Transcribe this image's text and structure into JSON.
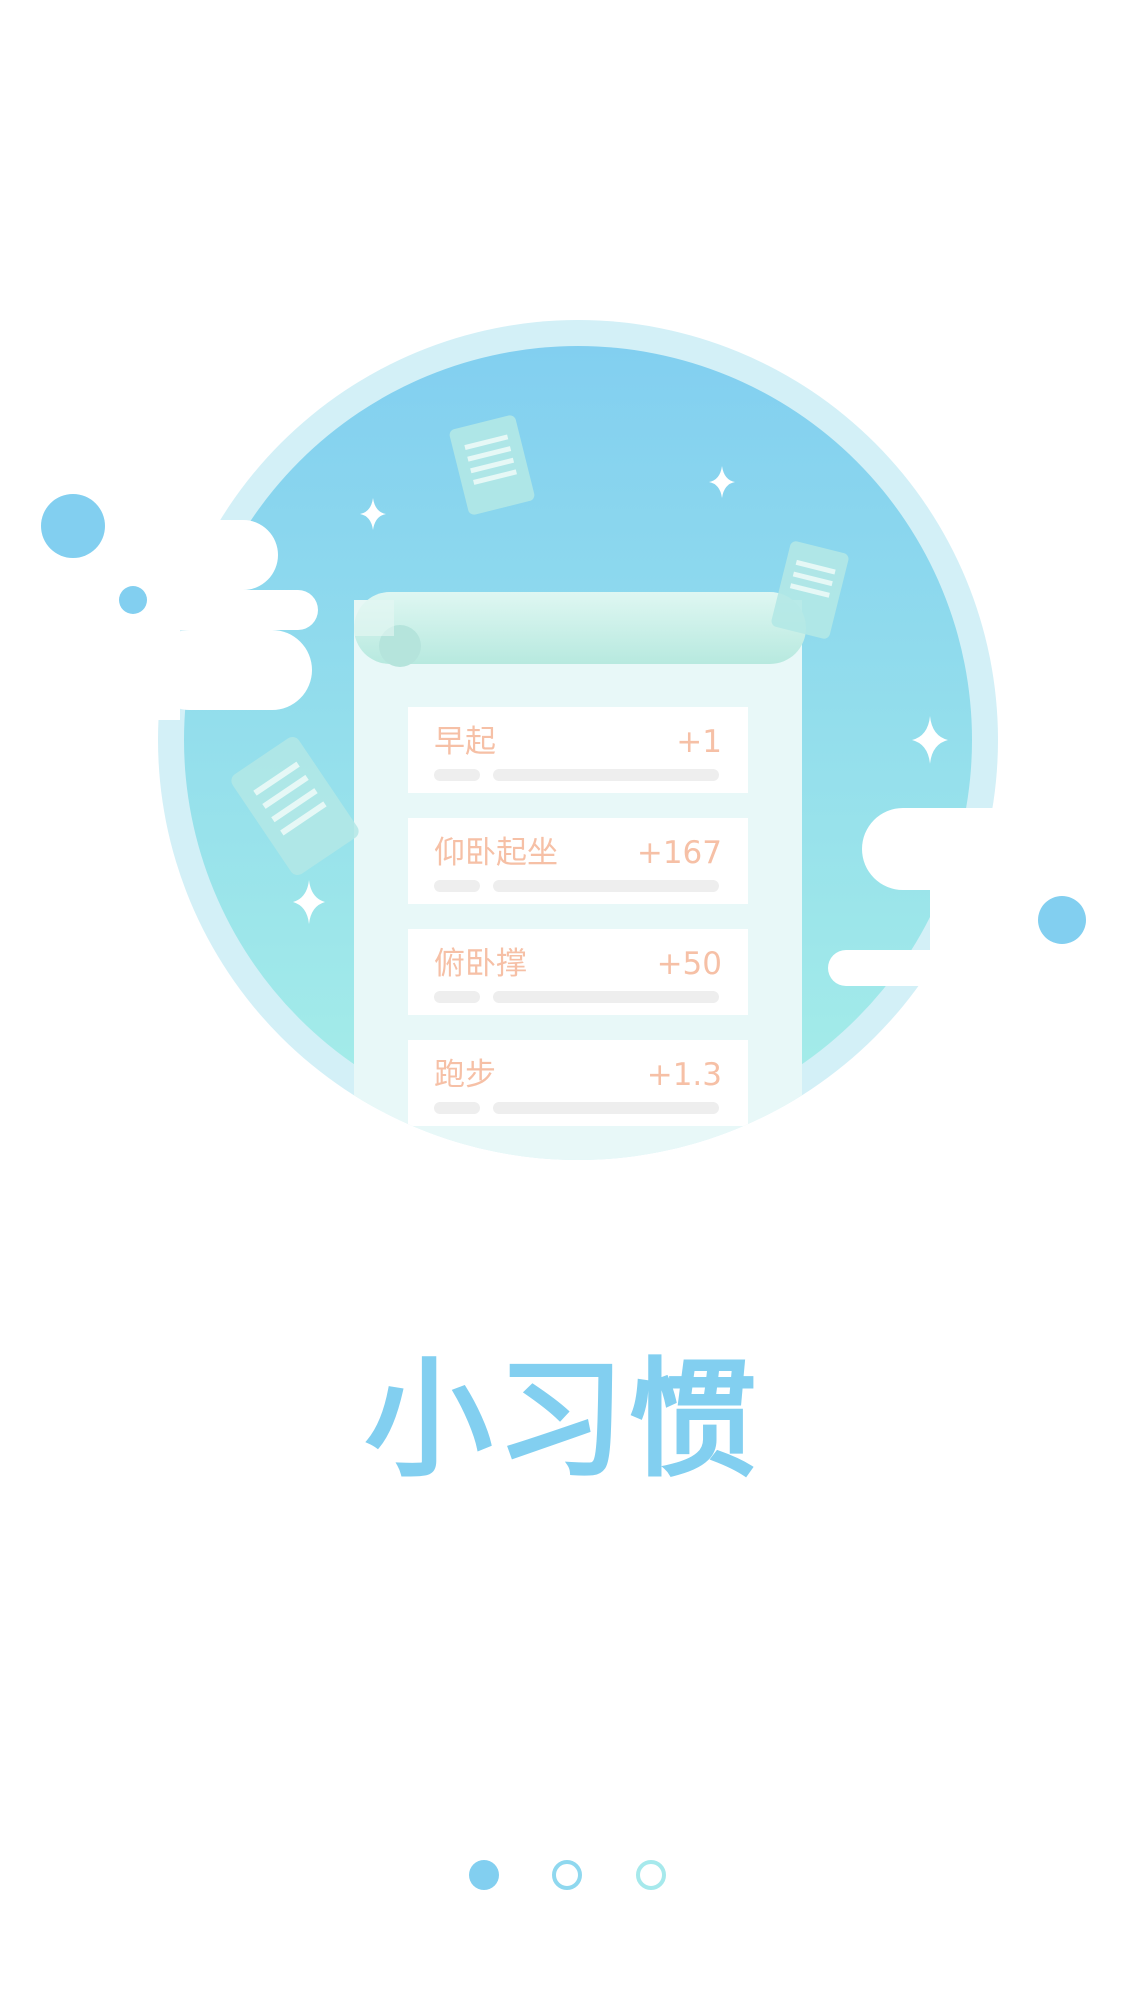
{
  "illustration": {
    "habit_items": [
      {
        "label": "早起",
        "value": "+1"
      },
      {
        "label": "仰卧起坐",
        "value": "+167"
      },
      {
        "label": "俯卧撑",
        "value": "+50"
      },
      {
        "label": "跑步",
        "value": "+1.3"
      }
    ]
  },
  "title": "小习惯",
  "pager": {
    "page_count": 3,
    "active_index": 0
  },
  "colors": {
    "brand_blue": "#82cff0",
    "text_peach": "#f6c0a6",
    "circle_top": "#82cff0",
    "circle_bottom": "#a4ece8"
  }
}
